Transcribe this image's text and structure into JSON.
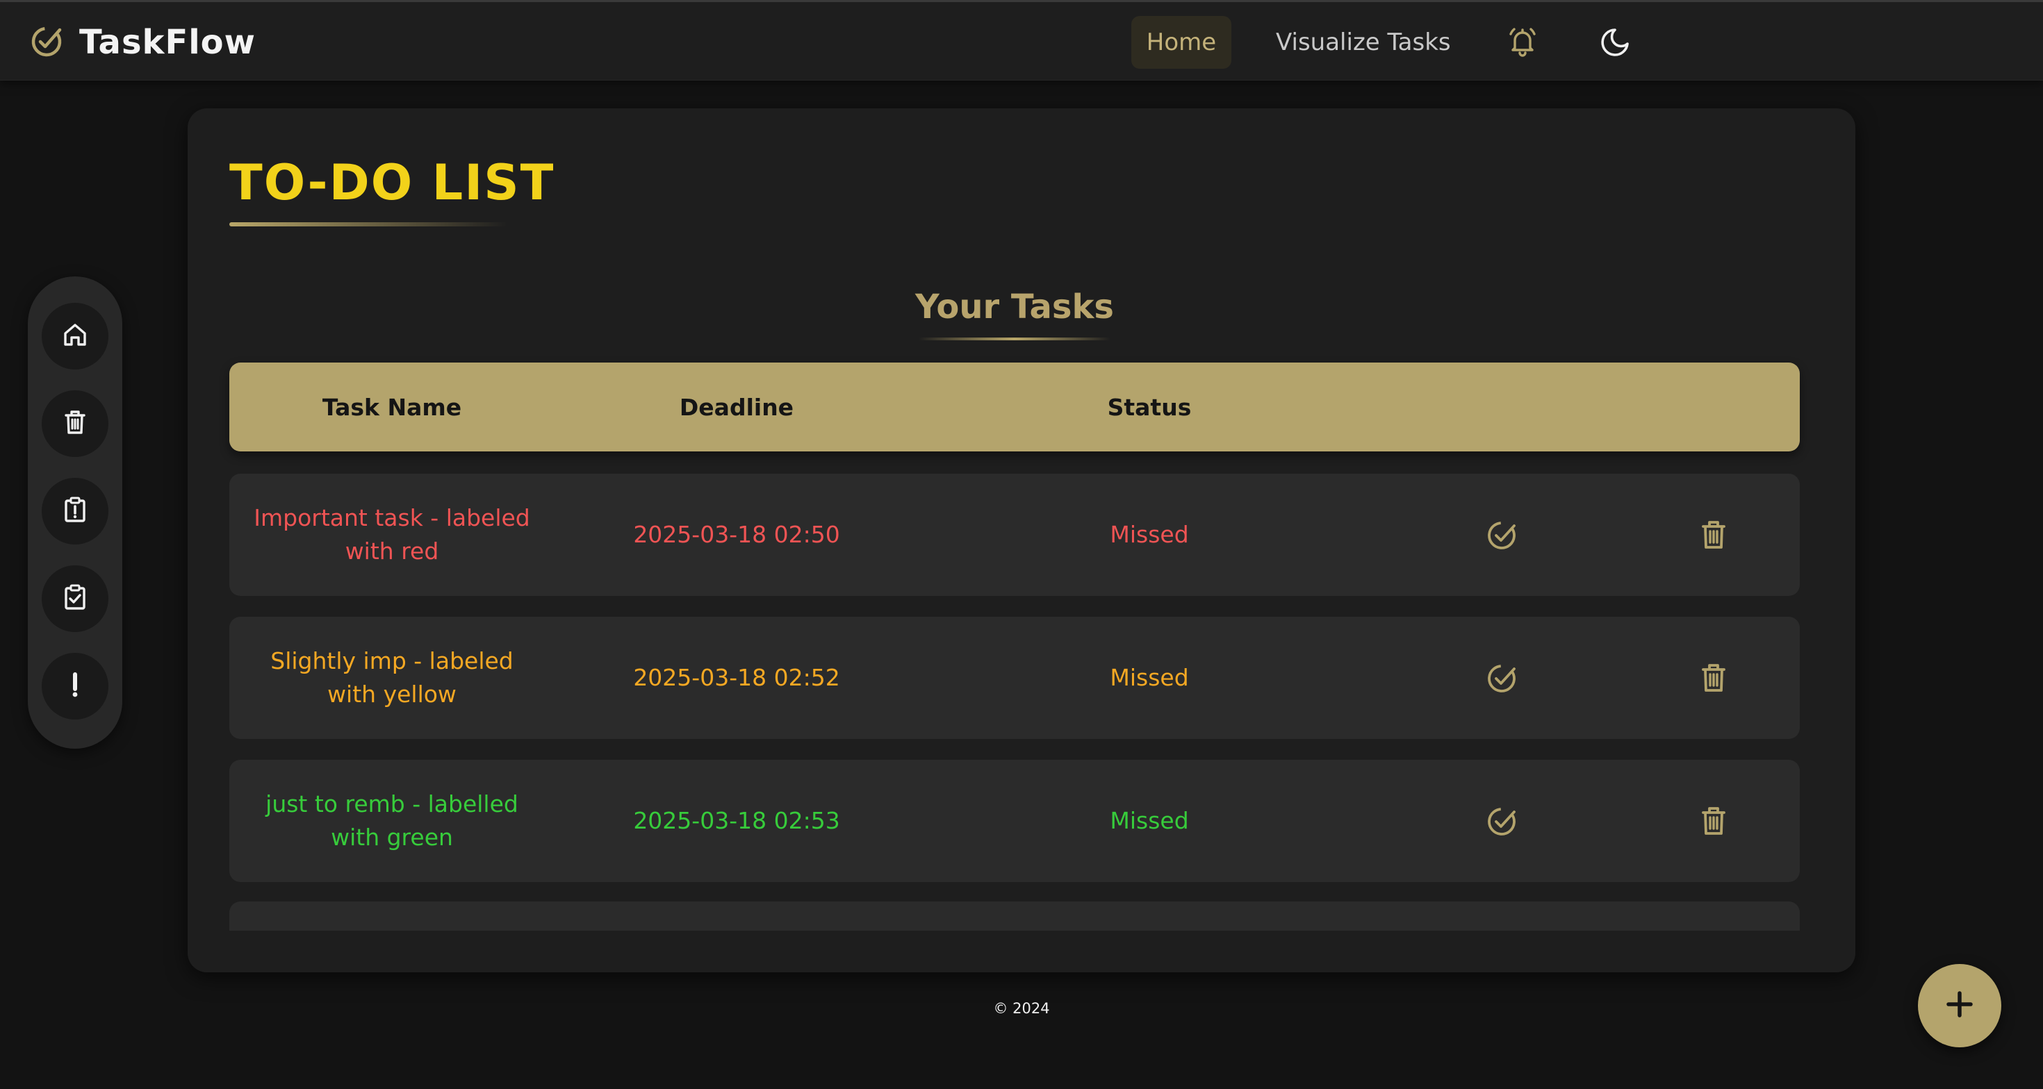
{
  "app": {
    "name": "TaskFlow"
  },
  "nav": {
    "home_label": "Home",
    "visualize_label": "Visualize Tasks"
  },
  "sidebar": {
    "items": [
      {
        "icon": "home-icon"
      },
      {
        "icon": "trash-icon"
      },
      {
        "icon": "clipboard-alert-icon"
      },
      {
        "icon": "clipboard-check-icon"
      },
      {
        "icon": "exclamation-icon"
      }
    ]
  },
  "main": {
    "title": "TO-DO LIST",
    "section_title": "Your Tasks",
    "columns": [
      "Task Name",
      "Deadline",
      "Status"
    ],
    "tasks": [
      {
        "name": "Important task - labeled with red",
        "deadline": "2025-03-18 02:50",
        "status": "Missed",
        "color": "#f05454"
      },
      {
        "name": "Slightly imp - labeled with yellow",
        "deadline": "2025-03-18 02:52",
        "status": "Missed",
        "color": "#f5a823"
      },
      {
        "name": "just to remb - labelled with green",
        "deadline": "2025-03-18 02:53",
        "status": "Missed",
        "color": "#37cc3b"
      }
    ]
  },
  "footer": {
    "copyright": "© 2024"
  },
  "colors": {
    "accent": "#b4a46c",
    "title": "#f2d21a",
    "background": "#131313",
    "card": "#1e1e1e"
  }
}
